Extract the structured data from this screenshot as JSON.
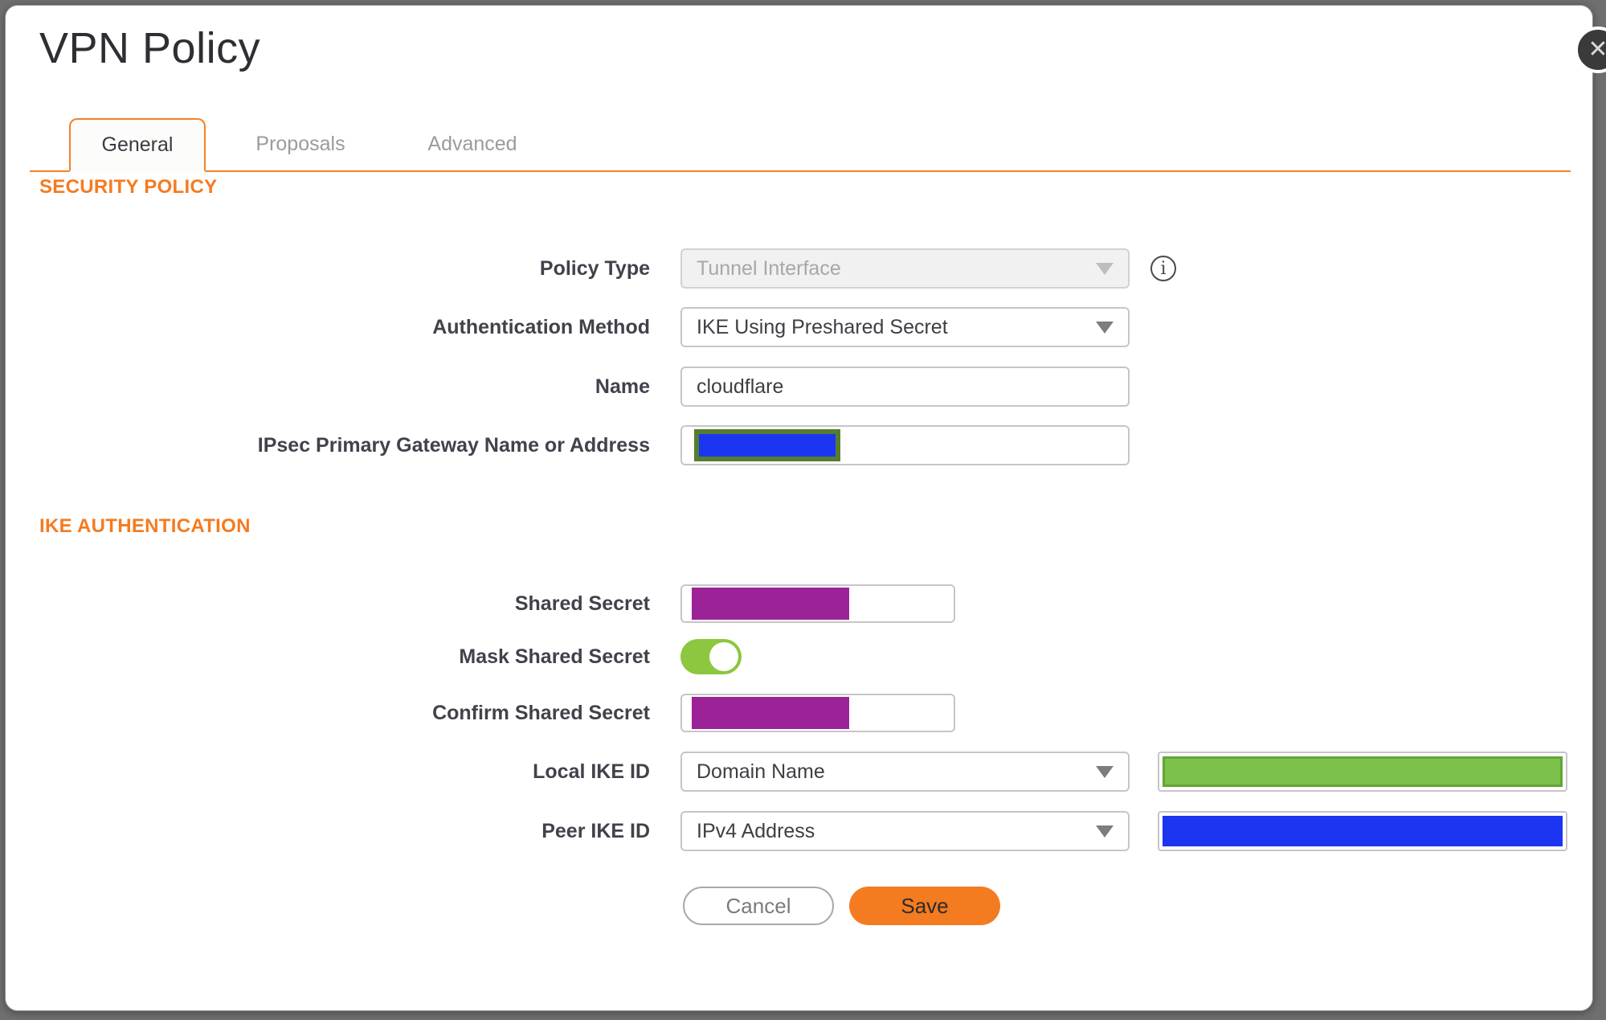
{
  "dialog": {
    "title": "VPN Policy",
    "close_icon": "✕"
  },
  "tabs": [
    {
      "label": "General",
      "active": true
    },
    {
      "label": "Proposals",
      "active": false
    },
    {
      "label": "Advanced",
      "active": false
    }
  ],
  "sections": {
    "security_policy_heading": "SECURITY POLICY",
    "ike_authentication_heading": "IKE AUTHENTICATION"
  },
  "fields": {
    "policy_type": {
      "label": "Policy Type",
      "value": "Tunnel Interface",
      "disabled": true,
      "info_icon": "i"
    },
    "auth_method": {
      "label": "Authentication Method",
      "value": "IKE Using Preshared Secret"
    },
    "name": {
      "label": "Name",
      "value": "cloudflare"
    },
    "gateway": {
      "label": "IPsec Primary Gateway Name or Address",
      "value": "",
      "redaction": "blue-box-olive-border"
    },
    "shared_secret": {
      "label": "Shared Secret",
      "value": "",
      "redaction": "purple-box"
    },
    "mask_shared_secret": {
      "label": "Mask Shared Secret",
      "state": "on"
    },
    "confirm_shared_secret": {
      "label": "Confirm Shared Secret",
      "value": "",
      "redaction": "purple-box"
    },
    "local_ike_id": {
      "label": "Local IKE ID",
      "value": "Domain Name",
      "redaction": "green-fill"
    },
    "peer_ike_id": {
      "label": "Peer IKE ID",
      "value": "IPv4 Address",
      "redaction": "blue-fill"
    }
  },
  "buttons": {
    "cancel": "Cancel",
    "save": "Save"
  },
  "colors": {
    "accent_orange": "#F47B20",
    "tab_underline": "#F58025",
    "label_text": "#41424B",
    "inactive_tab_text": "#9B9B9B",
    "page_background": "#6F6F6F",
    "close_button_bg": "#3A3A3A",
    "toggle_green": "#8DC63F",
    "redaction_purple": "#9B2397",
    "redaction_blue": "#1B35F0",
    "redaction_green": "#7CC14B",
    "redaction_olive_border": "#567D2E"
  }
}
